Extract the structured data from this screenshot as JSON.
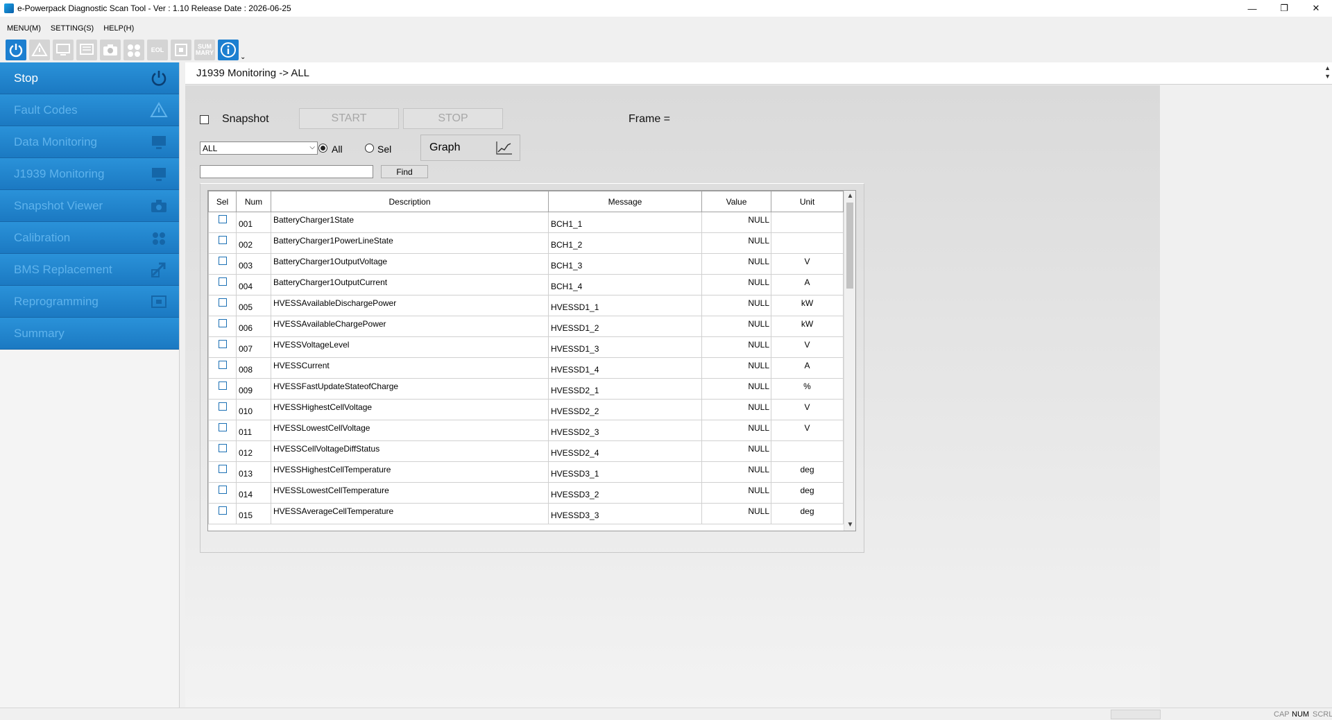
{
  "window": {
    "title": "e-Powerpack Diagnostic Scan Tool - Ver : 1.10 Release Date : 2026-06-25",
    "minimize": "—",
    "restore": "❐",
    "close": "✕"
  },
  "menu": {
    "items": [
      {
        "label": "MENU(M)"
      },
      {
        "label": "SETTING(S)"
      },
      {
        "label": "HELP(H)"
      }
    ]
  },
  "toolbar": {
    "eol_label": "EOL",
    "sum_label": "SUM\nMARY"
  },
  "sidebar": {
    "items": [
      {
        "label": "Stop",
        "icon": "power-icon",
        "active": true
      },
      {
        "label": "Fault Codes",
        "icon": "warning-icon",
        "active": false
      },
      {
        "label": "Data Monitoring",
        "icon": "monitor-icon",
        "active": false
      },
      {
        "label": "J1939 Monitoring",
        "icon": "monitor-icon",
        "active": false
      },
      {
        "label": "Snapshot Viewer",
        "icon": "camera-icon",
        "active": false
      },
      {
        "label": "Calibration",
        "icon": "gauge-icon",
        "active": false
      },
      {
        "label": "BMS Replacement",
        "icon": "swap-icon",
        "active": false
      },
      {
        "label": "Reprogramming",
        "icon": "chip-icon",
        "active": false
      },
      {
        "label": "Summary",
        "icon": "",
        "active": false
      }
    ]
  },
  "page": {
    "heading": "J1939 Monitoring -> ALL"
  },
  "controls": {
    "snapshot_label": "Snapshot",
    "start_label": "START",
    "stop_label": "STOP",
    "frame_label": "Frame =",
    "filter_value": "ALL",
    "radio_all": "All",
    "radio_sel": "Sel",
    "graph_label": "Graph",
    "search_value": "",
    "find_label": "Find"
  },
  "table": {
    "headers": {
      "sel": "Sel",
      "num": "Num",
      "description": "Description",
      "message": "Message",
      "value": "Value",
      "unit": "Unit"
    },
    "rows": [
      {
        "num": "001",
        "description": "BatteryCharger1State",
        "message": "BCH1_1",
        "value": "NULL",
        "unit": ""
      },
      {
        "num": "002",
        "description": "BatteryCharger1PowerLineState",
        "message": "BCH1_2",
        "value": "NULL",
        "unit": ""
      },
      {
        "num": "003",
        "description": "BatteryCharger1OutputVoltage",
        "message": "BCH1_3",
        "value": "NULL",
        "unit": "V"
      },
      {
        "num": "004",
        "description": "BatteryCharger1OutputCurrent",
        "message": "BCH1_4",
        "value": "NULL",
        "unit": "A"
      },
      {
        "num": "005",
        "description": "HVESSAvailableDischargePower",
        "message": "HVESSD1_1",
        "value": "NULL",
        "unit": "kW"
      },
      {
        "num": "006",
        "description": "HVESSAvailableChargePower",
        "message": "HVESSD1_2",
        "value": "NULL",
        "unit": "kW"
      },
      {
        "num": "007",
        "description": "HVESSVoltageLevel",
        "message": "HVESSD1_3",
        "value": "NULL",
        "unit": "V"
      },
      {
        "num": "008",
        "description": "HVESSCurrent",
        "message": "HVESSD1_4",
        "value": "NULL",
        "unit": "A"
      },
      {
        "num": "009",
        "description": "HVESSFastUpdateStateofCharge",
        "message": "HVESSD2_1",
        "value": "NULL",
        "unit": "%"
      },
      {
        "num": "010",
        "description": "HVESSHighestCellVoltage",
        "message": "HVESSD2_2",
        "value": "NULL",
        "unit": "V"
      },
      {
        "num": "011",
        "description": "HVESSLowestCellVoltage",
        "message": "HVESSD2_3",
        "value": "NULL",
        "unit": "V"
      },
      {
        "num": "012",
        "description": "HVESSCellVoltageDiffStatus",
        "message": "HVESSD2_4",
        "value": "NULL",
        "unit": ""
      },
      {
        "num": "013",
        "description": "HVESSHighestCellTemperature",
        "message": "HVESSD3_1",
        "value": "NULL",
        "unit": "deg"
      },
      {
        "num": "014",
        "description": "HVESSLowestCellTemperature",
        "message": "HVESSD3_2",
        "value": "NULL",
        "unit": "deg"
      },
      {
        "num": "015",
        "description": "HVESSAverageCellTemperature",
        "message": "HVESSD3_3",
        "value": "NULL",
        "unit": "deg"
      }
    ]
  },
  "status": {
    "cap": "CAP",
    "num": "NUM",
    "scrl": "SCRL"
  }
}
